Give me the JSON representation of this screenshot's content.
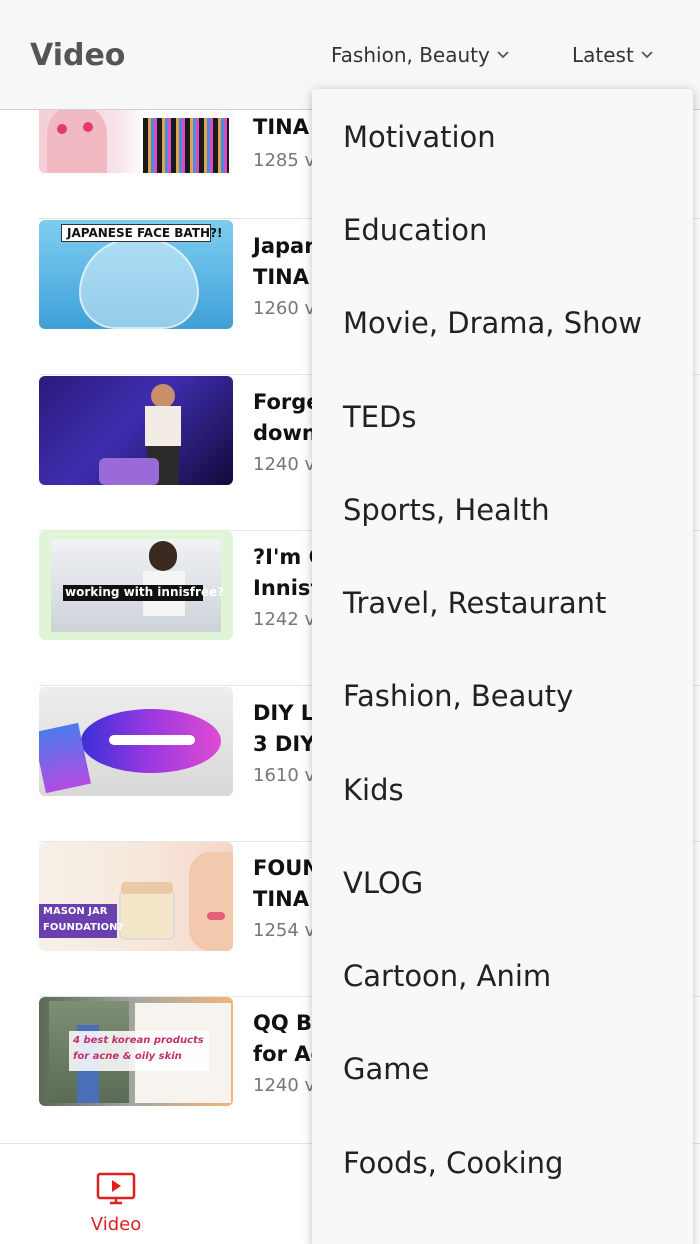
{
  "header": {
    "title": "Video",
    "category_filter": "Fashion, Beauty",
    "sort_filter": "Latest"
  },
  "videos": [
    {
      "title_line1": "TINA",
      "title_line2": "",
      "views": "1285 v",
      "thumb_caption": ""
    },
    {
      "title_line1": "Japan",
      "title_line2": "TINA",
      "views": "1260 v",
      "thumb_caption": "JAPANESE FACE BATH?!"
    },
    {
      "title_line1": "Forge",
      "title_line2": "down",
      "views": "1240 v",
      "thumb_caption": ""
    },
    {
      "title_line1": "?I'm C",
      "title_line2": "Innisf",
      "views": "1242 v",
      "thumb_caption": "working with innisfree?"
    },
    {
      "title_line1": "DIY L",
      "title_line2": "3 DIY",
      "views": "1610 v",
      "thumb_caption": ""
    },
    {
      "title_line1": "FOUN",
      "title_line2": "TINA",
      "views": "1254 v",
      "thumb_caption": "MASON JAR FOUNDATION?"
    },
    {
      "title_line1": "QQ B",
      "title_line2": "for Ac",
      "views": "1240 v",
      "thumb_caption": "4 best korean products for acne & oily skin"
    }
  ],
  "dropdown": {
    "items": [
      "Motivation",
      "Education",
      "Movie, Drama, Show",
      "TEDs",
      "Sports, Health",
      "Travel, Restaurant",
      "Fashion, Beauty",
      "Kids",
      "VLOG",
      "Cartoon, Anim",
      "Game",
      "Foods, Cooking"
    ]
  },
  "bottom_nav": {
    "video_label": "Video",
    "active_color": "#e02020"
  }
}
